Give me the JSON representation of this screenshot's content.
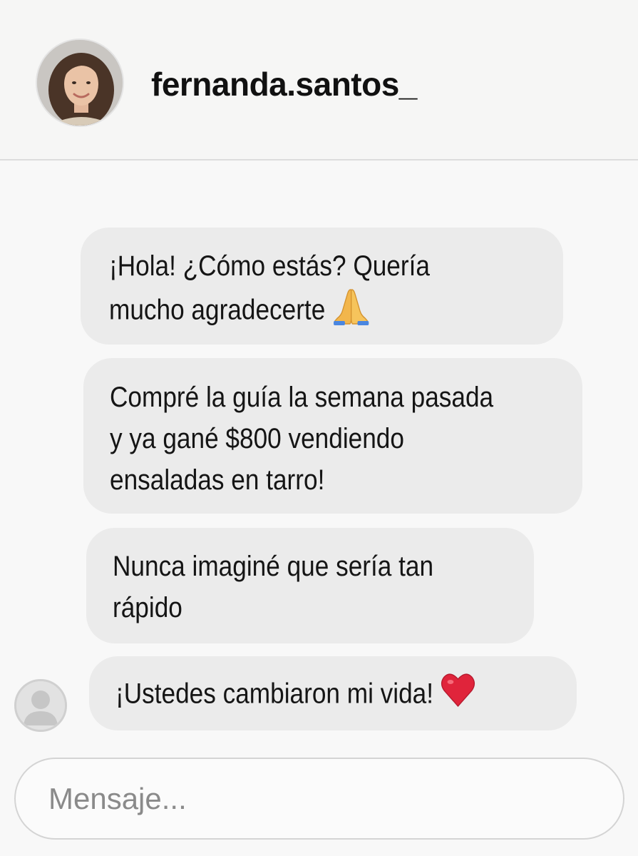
{
  "header": {
    "username": "fernanda.santos_"
  },
  "messages": [
    {
      "text": "¡Hola! ¿Cómo estás? Quería\nmucho agradecerte",
      "emoji": "folded-hands"
    },
    {
      "text": "Compré la guía la semana pasada\ny ya gané $800 vendiendo\nensaladas en tarro!"
    },
    {
      "text": "Nunca imaginé que sería tan\nrápido"
    },
    {
      "text": "¡Ustedes cambiaron mi vida!",
      "emoji": "red-heart"
    }
  ],
  "composer": {
    "placeholder": "Mensaje..."
  },
  "colors": {
    "bubble": "#ebebeb",
    "heart": "#e0243b",
    "hands": "#f2b64c"
  }
}
